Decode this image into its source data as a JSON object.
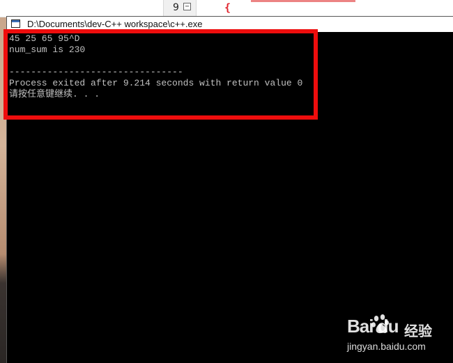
{
  "editor_behind": {
    "line_number": "9",
    "fold_glyph": "⊟",
    "brace": "{"
  },
  "console": {
    "title": "D:\\Documents\\dev-C++ workspace\\c++.exe",
    "lines": [
      "45 25 65 95^D",
      "num_sum is 230",
      "",
      "--------------------------------",
      "Process exited after 9.214 seconds with return value 0",
      "请按任意键继续. . ."
    ]
  },
  "watermark": {
    "logo_text": "Bai du",
    "cn_text": "经验",
    "url": "jingyan.baidu.com"
  },
  "colors": {
    "highlight": "#ee0d0d",
    "console_bg": "#000000",
    "console_text": "#c0c0c0"
  }
}
